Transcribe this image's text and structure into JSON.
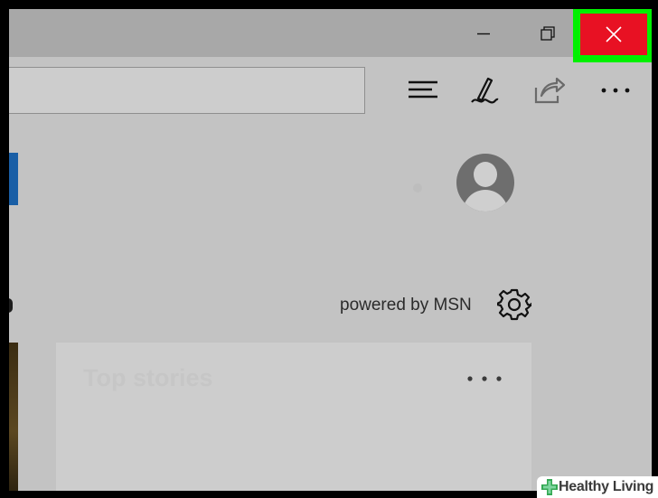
{
  "window": {
    "minimize_label": "",
    "restore_label": "",
    "close_label": "",
    "highlight_color": "#00f000",
    "close_color": "#e81123"
  },
  "toolbar": {
    "address_value": "",
    "icons": [
      "hub-icon",
      "web-note-icon",
      "share-icon",
      "more-icon"
    ]
  },
  "profile": {
    "icon": "avatar-icon"
  },
  "feed": {
    "powered_by": "powered by MSN",
    "settings_icon": "gear-icon",
    "card_title": "Top stories",
    "card_more_icon": "more-icon"
  },
  "watermark": {
    "text": "Healthy Living",
    "brand_color": "#34a853"
  }
}
